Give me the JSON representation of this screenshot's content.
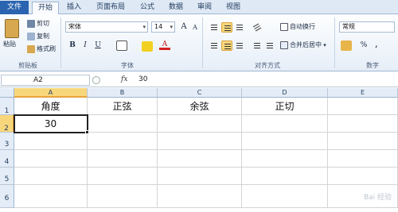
{
  "tabs": [
    "文件",
    "开始",
    "插入",
    "页面布局",
    "公式",
    "数据",
    "审阅",
    "视图"
  ],
  "clipboard": {
    "paste": "粘贴",
    "cut": "剪切",
    "copy": "复制",
    "format_painter": "格式刷",
    "label": "剪贴板"
  },
  "font": {
    "name": "宋体",
    "size": "14",
    "label": "字体",
    "bold": "B",
    "italic": "I",
    "underline": "U",
    "grow": "A",
    "shrink": "A"
  },
  "alignment": {
    "wrap": "自动换行",
    "merge": "合并后居中",
    "label": "对齐方式"
  },
  "number": {
    "format": "常规",
    "percent": "%",
    "comma": ",",
    "label": "数字"
  },
  "formula_bar": {
    "name_box": "A2",
    "fx": "fx",
    "value": "30"
  },
  "columns": [
    "A",
    "B",
    "C",
    "D",
    "E"
  ],
  "rows": [
    "1",
    "2",
    "3",
    "4",
    "5",
    "6"
  ],
  "cells": {
    "a1": "角度",
    "b1": "正弦",
    "c1": "余弦",
    "d1": "正切",
    "a2": "30"
  },
  "watermark": "Bai 经验",
  "colors": {
    "file_tab": "#2a63b0",
    "selection": "#f8d77c",
    "header": "#e4ecf7"
  }
}
